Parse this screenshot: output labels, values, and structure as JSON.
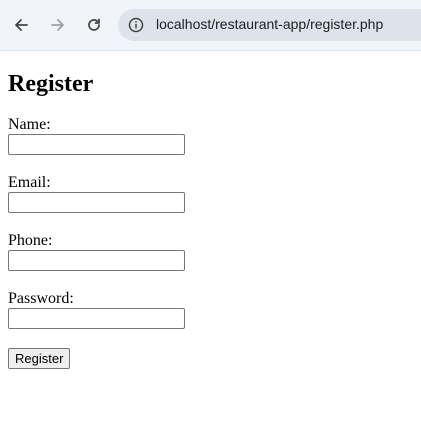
{
  "browser": {
    "url": "localhost/restaurant-app/register.php"
  },
  "form": {
    "title": "Register",
    "fields": [
      {
        "label": "Name:",
        "value": ""
      },
      {
        "label": "Email:",
        "value": ""
      },
      {
        "label": "Phone:",
        "value": ""
      },
      {
        "label": "Password:",
        "value": ""
      }
    ],
    "submit_label": "Register"
  }
}
